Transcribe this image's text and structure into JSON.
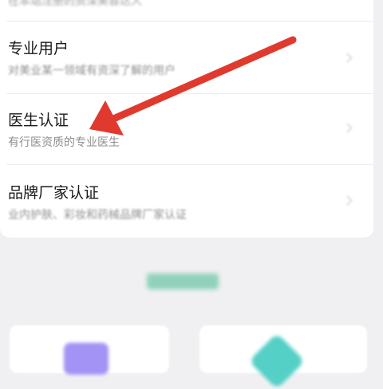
{
  "top_partial_text": "在本站注册的资深美容达人",
  "items": [
    {
      "title": "专业用户",
      "desc": "对美业某一领域有资深了解的用户"
    },
    {
      "title": "医生认证",
      "desc": "有行医资质的专业医生"
    },
    {
      "title": "品牌厂家认证",
      "desc": "业内护肤、彩妆和药械品牌厂家认证"
    }
  ],
  "colors": {
    "arrow": "#e03a2f",
    "banner": "#8fd1ba",
    "tile_icon_left": "#a293f5",
    "tile_icon_right": "#54d0c6"
  }
}
